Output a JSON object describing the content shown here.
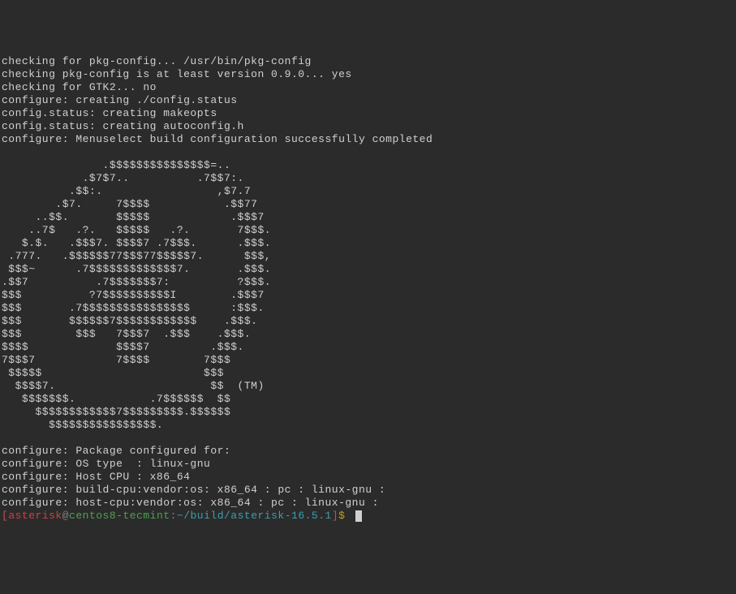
{
  "output_lines": [
    "checking for pkg-config... /usr/bin/pkg-config",
    "checking pkg-config is at least version 0.9.0... yes",
    "checking for GTK2... no",
    "configure: creating ./config.status",
    "config.status: creating makeopts",
    "config.status: creating autoconfig.h",
    "configure: Menuselect build configuration successfully completed",
    "",
    "               .$$$$$$$$$$$$$$$=..      ",
    "            .$7$7..          .7$$7:.    ",
    "          .$$:.                 ,$7.7   ",
    "        .$7.     7$$$$           .$$77  ",
    "     ..$$.       $$$$$            .$$$7 ",
    "    ..7$   .?.   $$$$$   .?.       7$$$.",
    "   $.$.   .$$$7. $$$$7 .7$$$.      .$$$.",
    " .777.   .$$$$$$77$$$77$$$$$7.      $$$,",
    " $$$~      .7$$$$$$$$$$$$$7.       .$$$.",
    ".$$7          .7$$$$$$$7:          ?$$$.",
    "$$$          ?7$$$$$$$$$$I        .$$$7 ",
    "$$$       .7$$$$$$$$$$$$$$$$      :$$$. ",
    "$$$       $$$$$$7$$$$$$$$$$$$    .$$$.  ",
    "$$$        $$$   7$$$7  .$$$    .$$$.   ",
    "$$$$             $$$$7         .$$$.    ",
    "7$$$7            7$$$$        7$$$      ",
    " $$$$$                        $$$       ",
    "  $$$$7.                       $$  (TM)",
    "   $$$$$$$.           .7$$$$$$  $$      ",
    "     $$$$$$$$$$$$7$$$$$$$$$.$$$$$$      ",
    "       $$$$$$$$$$$$$$$$.                ",
    "",
    "configure: Package configured for:",
    "configure: OS type  : linux-gnu",
    "configure: Host CPU : x86_64",
    "configure: build-cpu:vendor:os: x86_64 : pc : linux-gnu :",
    "configure: host-cpu:vendor:os: x86_64 : pc : linux-gnu :"
  ],
  "prompt": {
    "open_bracket": "[",
    "user": "asterisk",
    "at": "@",
    "host": "centos8-tecmint",
    "colon": ":",
    "path": "~/build/asterisk-16.5.1",
    "close_bracket": "]",
    "dollar": "$ "
  }
}
